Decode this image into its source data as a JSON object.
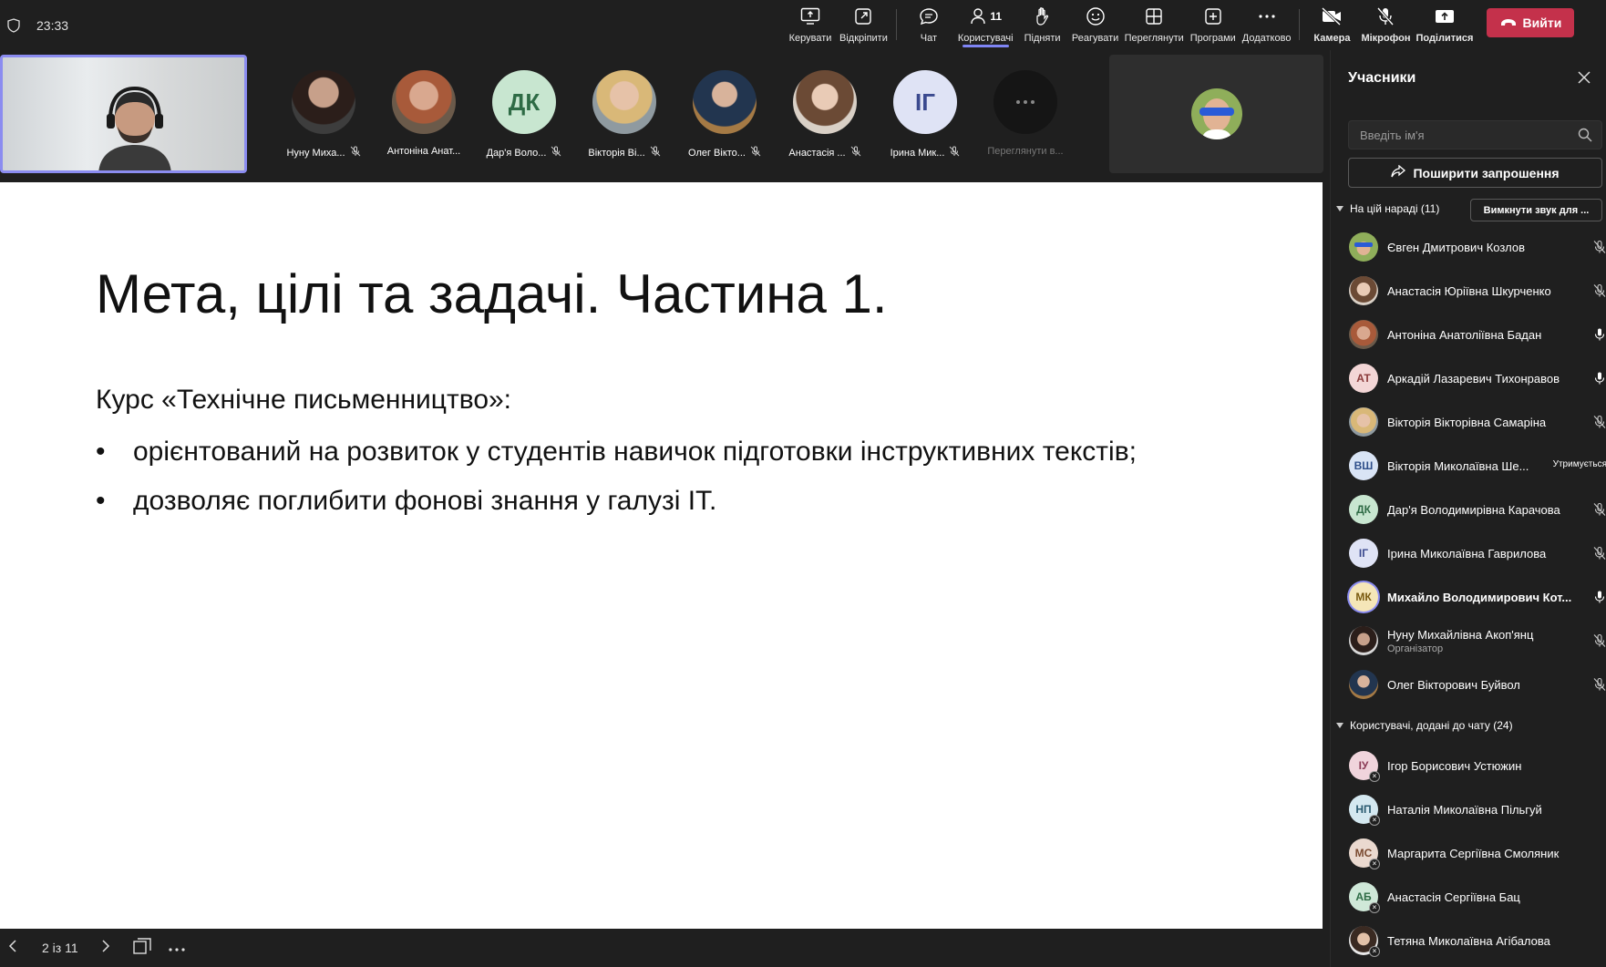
{
  "topbar": {
    "timer": "23:33",
    "tools": [
      {
        "label": "Керувати",
        "icon": "present-icon"
      },
      {
        "label": "Відкріпити",
        "icon": "popout-icon"
      },
      {
        "label": "Чат",
        "icon": "chat-icon"
      },
      {
        "label": "Користувачі",
        "icon": "people-icon",
        "count": "11",
        "active": true
      },
      {
        "label": "Підняти",
        "icon": "raise-hand-icon"
      },
      {
        "label": "Реагувати",
        "icon": "react-icon"
      },
      {
        "label": "Переглянути",
        "icon": "view-icon"
      },
      {
        "label": "Програми",
        "icon": "apps-icon"
      },
      {
        "label": "Додатково",
        "icon": "more-icon"
      }
    ],
    "camera_label": "Камера",
    "mic_label": "Мікрофон",
    "share_label": "Поділитися",
    "leave_label": "Вийти",
    "leave_color": "#c4314b",
    "accent_color": "#7f85f5"
  },
  "video_strip": {
    "tiles": [
      {
        "name": "Нуну Миха...",
        "initials": "",
        "muted": true
      },
      {
        "name": "Антоніна Анат...",
        "initials": "",
        "muted": false
      },
      {
        "name": "Дар'я Воло...",
        "initials": "ДК",
        "muted": true
      },
      {
        "name": "Вікторія Ві...",
        "initials": "",
        "muted": true
      },
      {
        "name": "Олег Вікто...",
        "initials": "",
        "muted": true
      },
      {
        "name": "Анастасія ...",
        "initials": "",
        "muted": true
      },
      {
        "name": "Ірина Мик...",
        "initials": "ІГ",
        "muted": true
      },
      {
        "name": "Переглянути в...",
        "initials": "",
        "muted": false
      }
    ]
  },
  "slide": {
    "title": "Мета, цілі та задачі. Частина 1.",
    "subtitle": "Курс «Технічне письменництво»:",
    "bullets": [
      "орієнтований на розвиток у студентів навичок підготовки інструктивних текстів;",
      "дозволяє поглибити фонові знання у галузі ІТ."
    ]
  },
  "bottombar": {
    "page_indicator": "2 із 11"
  },
  "panel": {
    "title": "Учасники",
    "search_placeholder": "Введіть ім'я",
    "invite_label": "Поширити запрошення",
    "in_meeting_header": "На цій нараді (11)",
    "mute_all_label": "Вимкнути звук для ...",
    "chat_added_header": "Користувачі, додані до чату (24)",
    "in_meeting": [
      {
        "name": "Євген Дмитрович Козлов",
        "initials": "",
        "mic": "muted"
      },
      {
        "name": "Анастасія Юріївна Шкурченко",
        "initials": "",
        "mic": "muted"
      },
      {
        "name": "Антоніна Анатоліївна Бадан",
        "initials": "",
        "mic": "on"
      },
      {
        "name": "Аркадій Лазаревич Тихонравов",
        "initials": "АТ",
        "mic": "on"
      },
      {
        "name": "Вікторія Вікторівна Самаріна",
        "initials": "",
        "mic": "muted"
      },
      {
        "name": "Вікторія Миколаївна Ше...",
        "initials": "ВШ",
        "mic": "status",
        "status": "Утримується"
      },
      {
        "name": "Дар'я Володимирівна Карачова",
        "initials": "ДК",
        "mic": "muted"
      },
      {
        "name": "Ірина Миколаївна Гаврилова",
        "initials": "ІГ",
        "mic": "muted"
      },
      {
        "name": "Михайло Володимирович Кот...",
        "initials": "МК",
        "mic": "on",
        "bold": true
      },
      {
        "name": "Нуну Михайлівна Акоп'янц",
        "role": "Організатор",
        "initials": "",
        "mic": "muted"
      },
      {
        "name": "Олег Вікторович Буйвол",
        "initials": "",
        "mic": "muted"
      }
    ],
    "chat_added": [
      {
        "name": "Ігор Борисович Устюжин",
        "initials": "ІУ"
      },
      {
        "name": "Наталія Миколаївна Пільгуй",
        "initials": "НП"
      },
      {
        "name": "Маргарита Сергіївна Смоляник",
        "initials": "МС"
      },
      {
        "name": "Анастасія Сергіївна Бац",
        "initials": "АБ"
      },
      {
        "name": "Тетяна Миколаївна Агібалова",
        "initials": ""
      }
    ]
  }
}
